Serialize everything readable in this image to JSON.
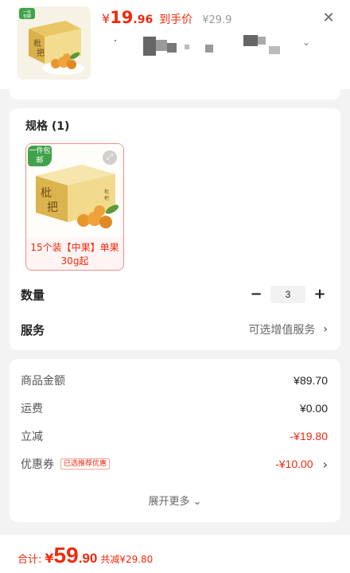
{
  "header": {
    "price_currency": "¥",
    "price_int": "19",
    "price_dec": ".96",
    "price_suffix": "到手价",
    "original_price": "¥29.9",
    "close_icon": "close-icon"
  },
  "spec": {
    "title": "规格 (1)",
    "badge": "一件包邮",
    "option_label": "15个装【中果】单果30g起",
    "product_text": "枇杷"
  },
  "quantity": {
    "label": "数量",
    "value": "3",
    "minus": "−",
    "plus": "+"
  },
  "service": {
    "label": "服务",
    "value": "可选增值服务"
  },
  "summary": {
    "rows": [
      {
        "label": "商品金额",
        "value": "¥89.70"
      },
      {
        "label": "运费",
        "value": "¥0.00"
      },
      {
        "label": "立减",
        "value": "-¥19.80"
      },
      {
        "label": "优惠券",
        "tag": "已选推荐优惠",
        "value": "-¥10.00"
      }
    ],
    "more": "展开更多"
  },
  "footer": {
    "label": "合计:",
    "currency": "¥",
    "total_int": "59",
    "total_dec": ".90",
    "saved": "共减¥29.80"
  },
  "colors": {
    "accent": "#f2290c",
    "badge_green": "#40a34a"
  }
}
